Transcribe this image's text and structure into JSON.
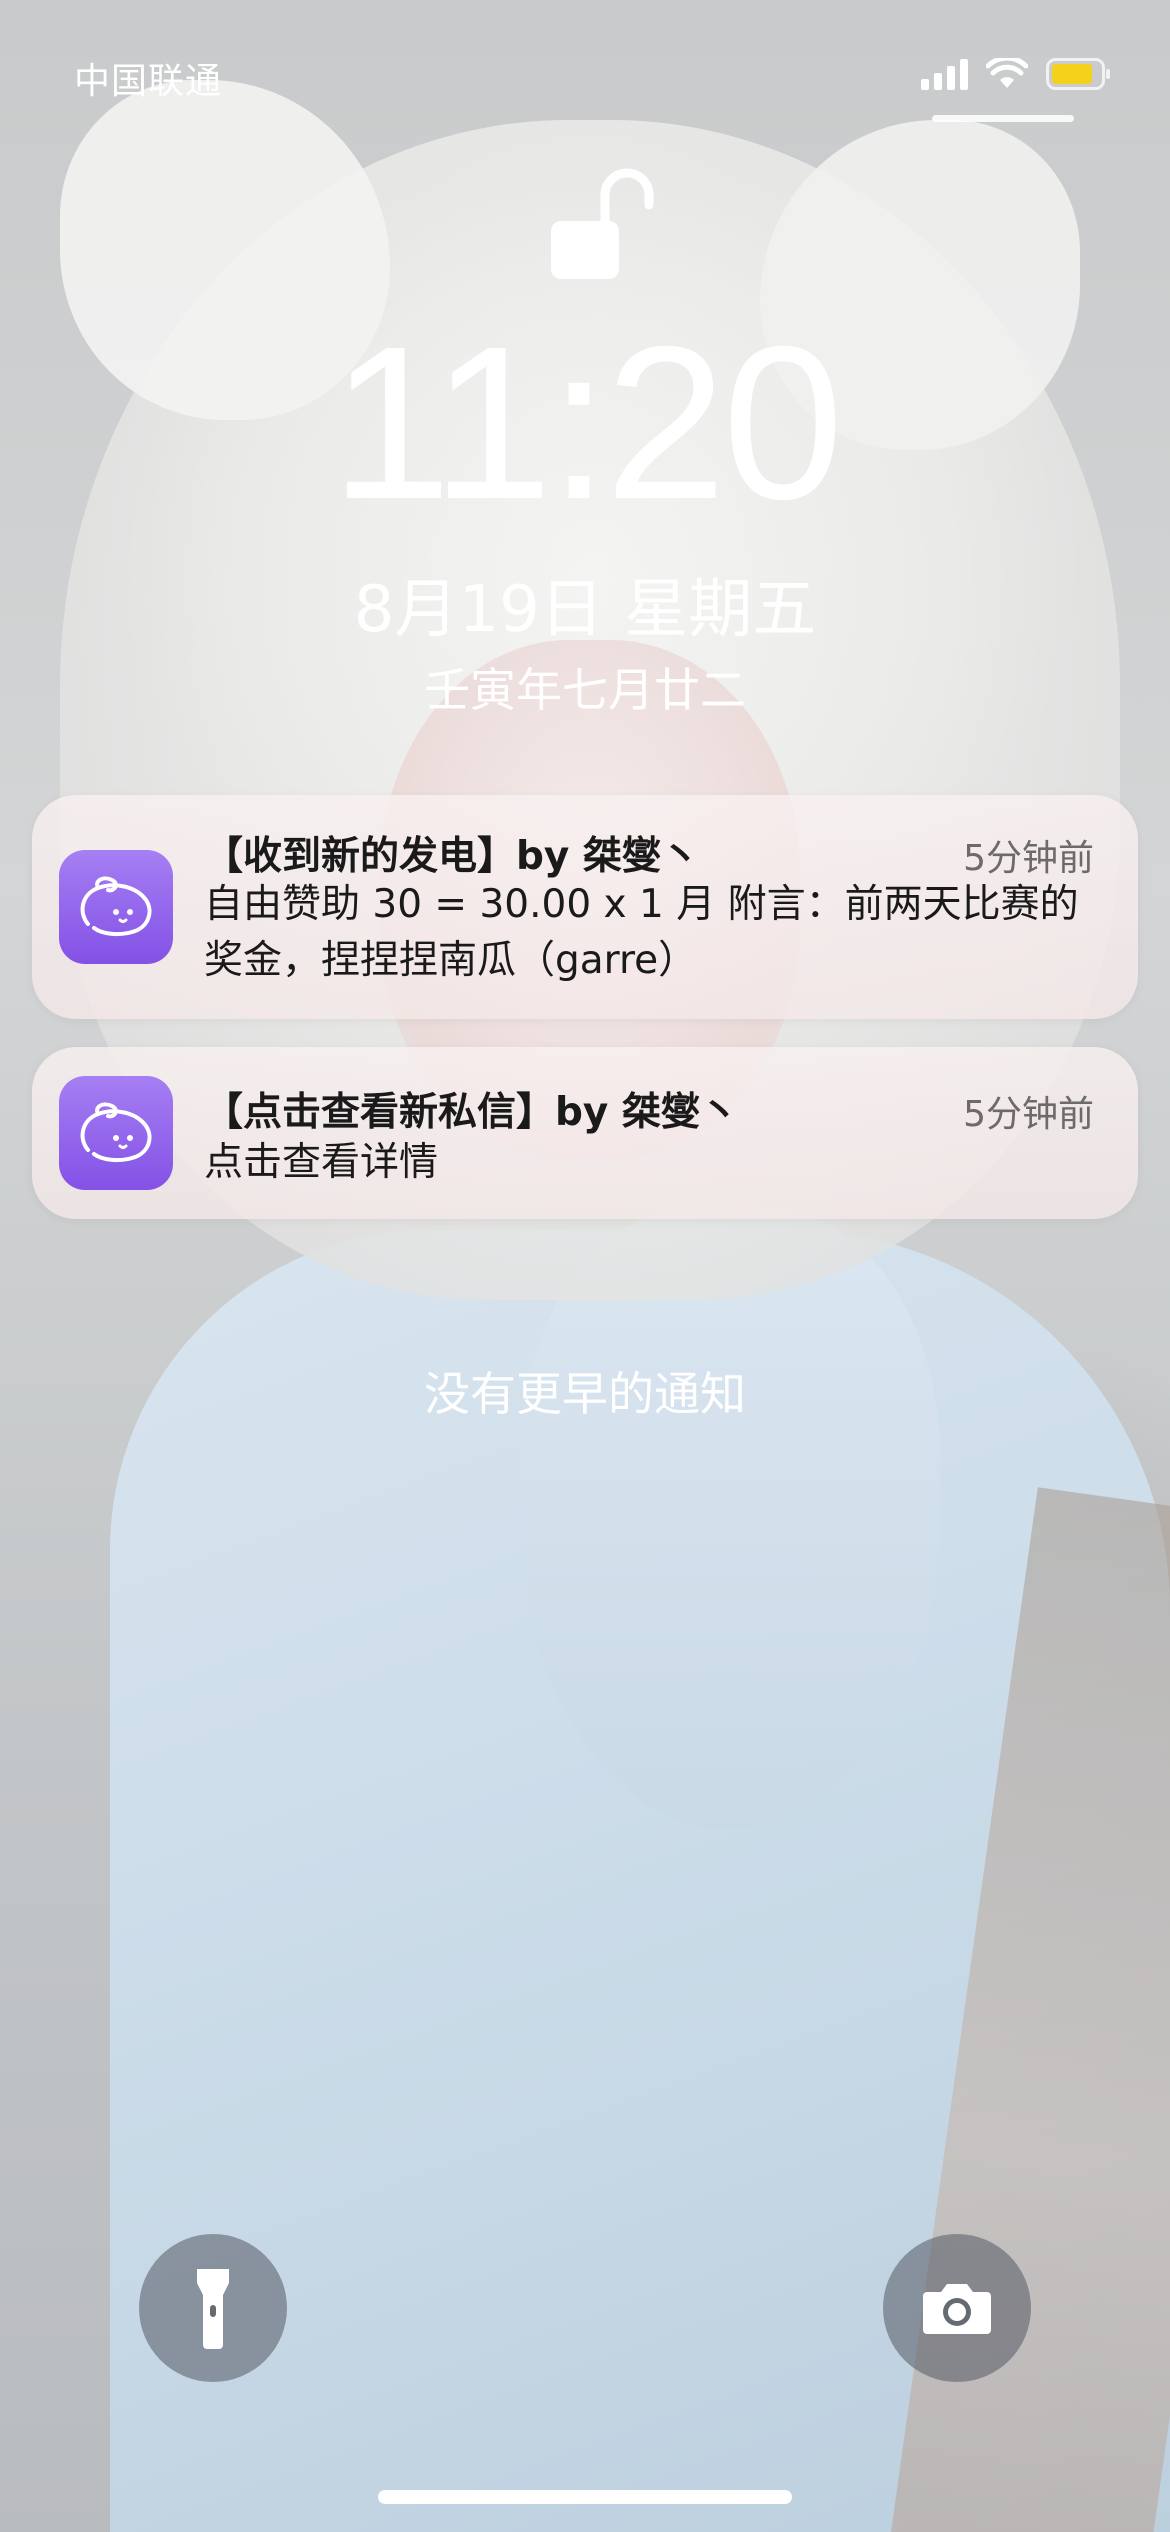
{
  "status_bar": {
    "carrier": "中国联通",
    "signal_bars": 4,
    "battery_color": "#f5d21a"
  },
  "lock_screen": {
    "lock_state": "unlocked",
    "time": "11:20",
    "date": "8月19日 星期五",
    "lunar_date": "壬寅年七月廿二"
  },
  "notifications": [
    {
      "app_icon": "afdian-app-icon",
      "title": "【收到新的发电】by 桀燮丶",
      "time": "5分钟前",
      "body": "自由赞助 30 = 30.00 x 1 月 附言：前两天比赛的奖金，捏捏捏南瓜（garre）"
    },
    {
      "app_icon": "afdian-app-icon",
      "title": "【点击查看新私信】by 桀燮丶",
      "time": "5分钟前",
      "body": "点击查看详情"
    }
  ],
  "no_earlier_notifications": "没有更早的通知",
  "bottom_controls": {
    "left_icon": "flashlight-icon",
    "right_icon": "camera-icon"
  },
  "colors": {
    "app_icon_purple": "#9164ec",
    "notification_bg": "#f6eeee",
    "text_primary": "#1a1a1a",
    "text_secondary": "#6d6a6a"
  }
}
